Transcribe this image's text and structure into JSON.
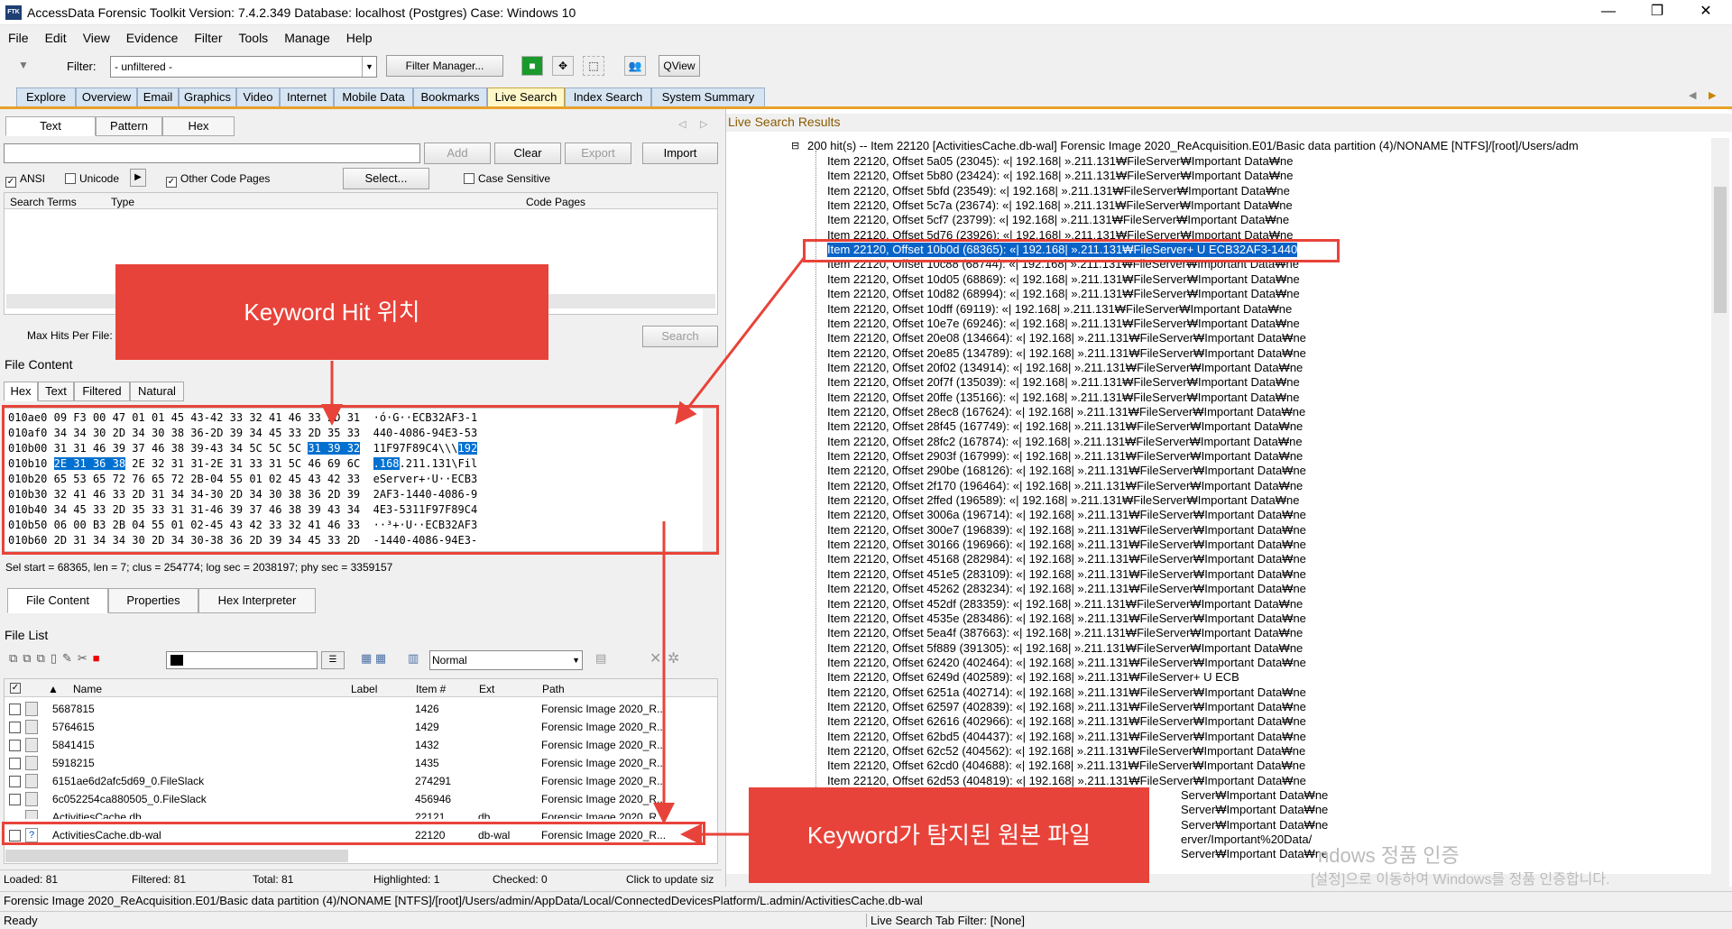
{
  "window": {
    "title": "AccessData Forensic Toolkit Version: 7.4.2.349 Database: localhost (Postgres) Case: Windows 10",
    "app_icon": "FTK",
    "minimize": "—",
    "maximize": "❐",
    "close": "✕"
  },
  "menu": [
    "File",
    "Edit",
    "View",
    "Evidence",
    "Filter",
    "Tools",
    "Manage",
    "Help"
  ],
  "toolbar": {
    "filter_label": "Filter:",
    "filter_value": "- unfiltered -",
    "filter_manager": "Filter Manager...",
    "qview": "QView"
  },
  "main_tabs": [
    "Explore",
    "Overview",
    "Email",
    "Graphics",
    "Video",
    "Internet",
    "Mobile Data",
    "Bookmarks",
    "Live Search",
    "Index Search",
    "System Summary"
  ],
  "live_search": {
    "tabs": [
      "Text",
      "Pattern",
      "Hex"
    ],
    "buttons": {
      "add": "Add",
      "clear": "Clear",
      "export": "Export",
      "import": "Import",
      "select": "Select...",
      "search": "Search"
    },
    "options": {
      "ansi": "ANSI",
      "unicode": "Unicode",
      "other_code_pages": "Other Code Pages",
      "case_sensitive": "Case Sensitive"
    },
    "columns": [
      "Search Terms",
      "Type",
      "Code Pages"
    ],
    "max_hits_label": "Max Hits Per File:"
  },
  "file_content": {
    "title": "File Content",
    "tabs": [
      "Hex",
      "Text",
      "Filtered",
      "Natural"
    ],
    "hex_rows": [
      {
        "addr": "010ae0",
        "bytes": "09 F3 00 47 01 01 45 43-42 33 32 41 46 33 2D 31",
        "ascii": "·ó·G··ECB32AF3-1"
      },
      {
        "addr": "010af0",
        "bytes": "34 34 30 2D 34 30 38 36-2D 39 34 45 33 2D 35 33",
        "ascii": "440-4086-94E3-53"
      },
      {
        "addr": "010b00",
        "bytes_pre": "31 31 46 39 37 46 38 39-43 34 5C 5C 5C ",
        "bytes_hl": "31 39 32",
        "ascii_pre": "11F97F89C4\\\\\\",
        "ascii_hl": "192"
      },
      {
        "addr": "010b10",
        "bytes_hl": "2E 31 36 38",
        "bytes_post": " 2E 32 31 31-2E 31 33 31 5C 46 69 6C",
        "ascii_hl": ".168",
        "ascii_post": ".211.131\\Fil"
      },
      {
        "addr": "010b20",
        "bytes": "65 53 65 72 76 65 72 2B-04 55 01 02 45 43 42 33",
        "ascii": "eServer+·U··ECB3"
      },
      {
        "addr": "010b30",
        "bytes": "32 41 46 33 2D 31 34 34-30 2D 34 30 38 36 2D 39",
        "ascii": "2AF3-1440-4086-9"
      },
      {
        "addr": "010b40",
        "bytes": "34 45 33 2D 35 33 31 31-46 39 37 46 38 39 43 34",
        "ascii": "4E3-5311F97F89C4"
      },
      {
        "addr": "010b50",
        "bytes": "06 00 B3 2B 04 55 01 02-45 43 42 33 32 41 46 33",
        "ascii": "··³+·U··ECB32AF3"
      },
      {
        "addr": "010b60",
        "bytes": "2D 31 34 34 30 2D 34 30-38 36 2D 39 34 45 33 2D",
        "ascii": "-1440-4086-94E3-"
      }
    ],
    "sel_status": "Sel start = 68365, len = 7; clus = 254774; log sec = 2038197; phy sec = 3359157",
    "bottom_tabs": [
      "File Content",
      "Properties",
      "Hex Interpreter"
    ]
  },
  "file_list": {
    "title": "File List",
    "view_mode": "Normal",
    "columns": [
      "Name",
      "Label",
      "Item #",
      "Ext",
      "Path"
    ],
    "rows": [
      {
        "name": "5687815",
        "label": "",
        "item": "1426",
        "ext": "",
        "path": "Forensic Image 2020_R..."
      },
      {
        "name": "5764615",
        "label": "",
        "item": "1429",
        "ext": "",
        "path": "Forensic Image 2020_R..."
      },
      {
        "name": "5841415",
        "label": "",
        "item": "1432",
        "ext": "",
        "path": "Forensic Image 2020_R..."
      },
      {
        "name": "5918215",
        "label": "",
        "item": "1435",
        "ext": "",
        "path": "Forensic Image 2020_R..."
      },
      {
        "name": "6151ae6d2afc5d69_0.FileSlack",
        "label": "",
        "item": "274291",
        "ext": "",
        "path": "Forensic Image 2020_R..."
      },
      {
        "name": "6c052254ca880505_0.FileSlack",
        "label": "",
        "item": "456946",
        "ext": "",
        "path": "Forensic Image 2020_R..."
      },
      {
        "name": "ActivitiesCache.db",
        "label": "",
        "item": "22121",
        "ext": "db",
        "path": "Forensic Image 2020_R..."
      },
      {
        "name": "ActivitiesCache.db-wal",
        "label": "",
        "item": "22120",
        "ext": "db-wal",
        "path": "Forensic Image 2020_R..."
      }
    ],
    "status": {
      "loaded": "Loaded: 81",
      "filtered": "Filtered: 81",
      "total": "Total: 81",
      "highlighted": "Highlighted: 1",
      "checked": "Checked: 0",
      "update": "Click to update siz"
    }
  },
  "results": {
    "header": "Live Search Results",
    "root": "200 hit(s) -- Item 22120 [ActivitiesCache.db-wal] Forensic Image 2020_ReAcquisition.E01/Basic data partition (4)/NONAME [NTFS]/[root]/Users/adm",
    "lines": [
      "Item 22120, Offset 5a05 (23045): «| 192.168| ».211.131₩FileServer₩Important Data₩ne",
      "Item 22120, Offset 5b80 (23424): «| 192.168| ».211.131₩FileServer₩Important Data₩ne",
      "Item 22120, Offset 5bfd (23549): «| 192.168| ».211.131₩FileServer₩Important Data₩ne",
      "Item 22120, Offset 5c7a (23674): «| 192.168| ».211.131₩FileServer₩Important Data₩ne",
      "Item 22120, Offset 5cf7 (23799): «| 192.168| ».211.131₩FileServer₩Important Data₩ne",
      "Item 22120, Offset 5d76 (23926): «| 192.168| ».211.131₩FileServer₩Important Data₩ne",
      "Item 22120, Offset 10b0d (68365): «| 192.168| ».211.131₩FileServer+ U  ECB32AF3-1440",
      "Item 22120, Offset 10c88 (68744): «| 192.168| ».211.131₩FileServer₩Important Data₩ne",
      "Item 22120, Offset 10d05 (68869): «| 192.168| ».211.131₩FileServer₩Important Data₩ne",
      "Item 22120, Offset 10d82 (68994): «| 192.168| ».211.131₩FileServer₩Important Data₩ne",
      "Item 22120, Offset 10dff (69119): «| 192.168| ».211.131₩FileServer₩Important Data₩ne",
      "Item 22120, Offset 10e7e (69246): «| 192.168| ».211.131₩FileServer₩Important Data₩ne",
      "Item 22120, Offset 20e08 (134664): «| 192.168| ».211.131₩FileServer₩Important Data₩ne",
      "Item 22120, Offset 20e85 (134789): «| 192.168| ».211.131₩FileServer₩Important Data₩ne",
      "Item 22120, Offset 20f02 (134914): «| 192.168| ».211.131₩FileServer₩Important Data₩ne",
      "Item 22120, Offset 20f7f (135039): «| 192.168| ».211.131₩FileServer₩Important Data₩ne",
      "Item 22120, Offset 20ffe (135166): «| 192.168| ».211.131₩FileServer₩Important Data₩ne",
      "Item 22120, Offset 28ec8 (167624): «| 192.168| ».211.131₩FileServer₩Important Data₩ne",
      "Item 22120, Offset 28f45 (167749): «| 192.168| ».211.131₩FileServer₩Important Data₩ne",
      "Item 22120, Offset 28fc2 (167874): «| 192.168| ».211.131₩FileServer₩Important Data₩ne",
      "Item 22120, Offset 2903f (167999): «| 192.168| ».211.131₩FileServer₩Important Data₩ne",
      "Item 22120, Offset 290be (168126): «| 192.168| ».211.131₩FileServer₩Important Data₩ne",
      "Item 22120, Offset 2f170 (196464): «| 192.168| ».211.131₩FileServer₩Important Data₩ne",
      "Item 22120, Offset 2ffed (196589): «| 192.168| ».211.131₩FileServer₩Important Data₩ne",
      "Item 22120, Offset 3006a (196714): «| 192.168| ».211.131₩FileServer₩Important Data₩ne",
      "Item 22120, Offset 300e7 (196839): «| 192.168| ».211.131₩FileServer₩Important Data₩ne",
      "Item 22120, Offset 30166 (196966): «| 192.168| ».211.131₩FileServer₩Important Data₩ne",
      "Item 22120, Offset 45168 (282984): «| 192.168| ».211.131₩FileServer₩Important Data₩ne",
      "Item 22120, Offset 451e5 (283109): «| 192.168| ».211.131₩FileServer₩Important Data₩ne",
      "Item 22120, Offset 45262 (283234): «| 192.168| ».211.131₩FileServer₩Important Data₩ne",
      "Item 22120, Offset 452df (283359): «| 192.168| ».211.131₩FileServer₩Important Data₩ne",
      "Item 22120, Offset 4535e (283486): «| 192.168| ».211.131₩FileServer₩Important Data₩ne",
      "Item 22120, Offset 5ea4f (387663): «| 192.168| ».211.131₩FileServer₩Important Data₩ne",
      "Item 22120, Offset 5f889 (391305): «| 192.168| ».211.131₩FileServer₩Important Data₩ne",
      "Item 22120, Offset 62420 (402464): «| 192.168| ».211.131₩FileServer₩Important Data₩ne",
      "Item 22120, Offset 6249d (402589): «| 192.168| ».211.131₩FileServer+ U  ECB",
      "Item 22120, Offset 6251a (402714): «| 192.168| ».211.131₩FileServer₩Important Data₩ne",
      "Item 22120, Offset 62597 (402839): «| 192.168| ».211.131₩FileServer₩Important Data₩ne",
      "Item 22120, Offset 62616 (402966): «| 192.168| ».211.131₩FileServer₩Important Data₩ne",
      "Item 22120, Offset 62bd5 (404437): «| 192.168| ».211.131₩FileServer₩Important Data₩ne",
      "Item 22120, Offset 62c52 (404562): «| 192.168| ».211.131₩FileServer₩Important Data₩ne",
      "Item 22120, Offset 62cd0 (404688): «| 192.168| ».211.131₩FileServer₩Important Data₩ne",
      "Item 22120, Offset 62d53 (404819): «| 192.168| ».211.131₩FileServer₩Important Data₩ne",
      "Server₩Important Data₩ne",
      "Server₩Important Data₩ne",
      "Server₩Important Data₩ne",
      "erver/Important%20Data/",
      "Server₩Important Data₩ne"
    ]
  },
  "annotations": {
    "keyword_hit": "Keyword Hit 위치",
    "source_file": "Keyword가 탐지된 원본 파일"
  },
  "watermark": {
    "line1": "ndows 정품 인증",
    "line2": "[설정]으로 이동하여 Windows를 정품 인증합니다."
  },
  "status": {
    "path": "Forensic Image 2020_ReAcquisition.E01/Basic data partition (4)/NONAME [NTFS]/[root]/Users/admin/AppData/Local/ConnectedDevicesPlatform/L.admin/ActivitiesCache.db-wal",
    "ready": "Ready",
    "filter": "Live Search Tab Filter: [None]"
  }
}
